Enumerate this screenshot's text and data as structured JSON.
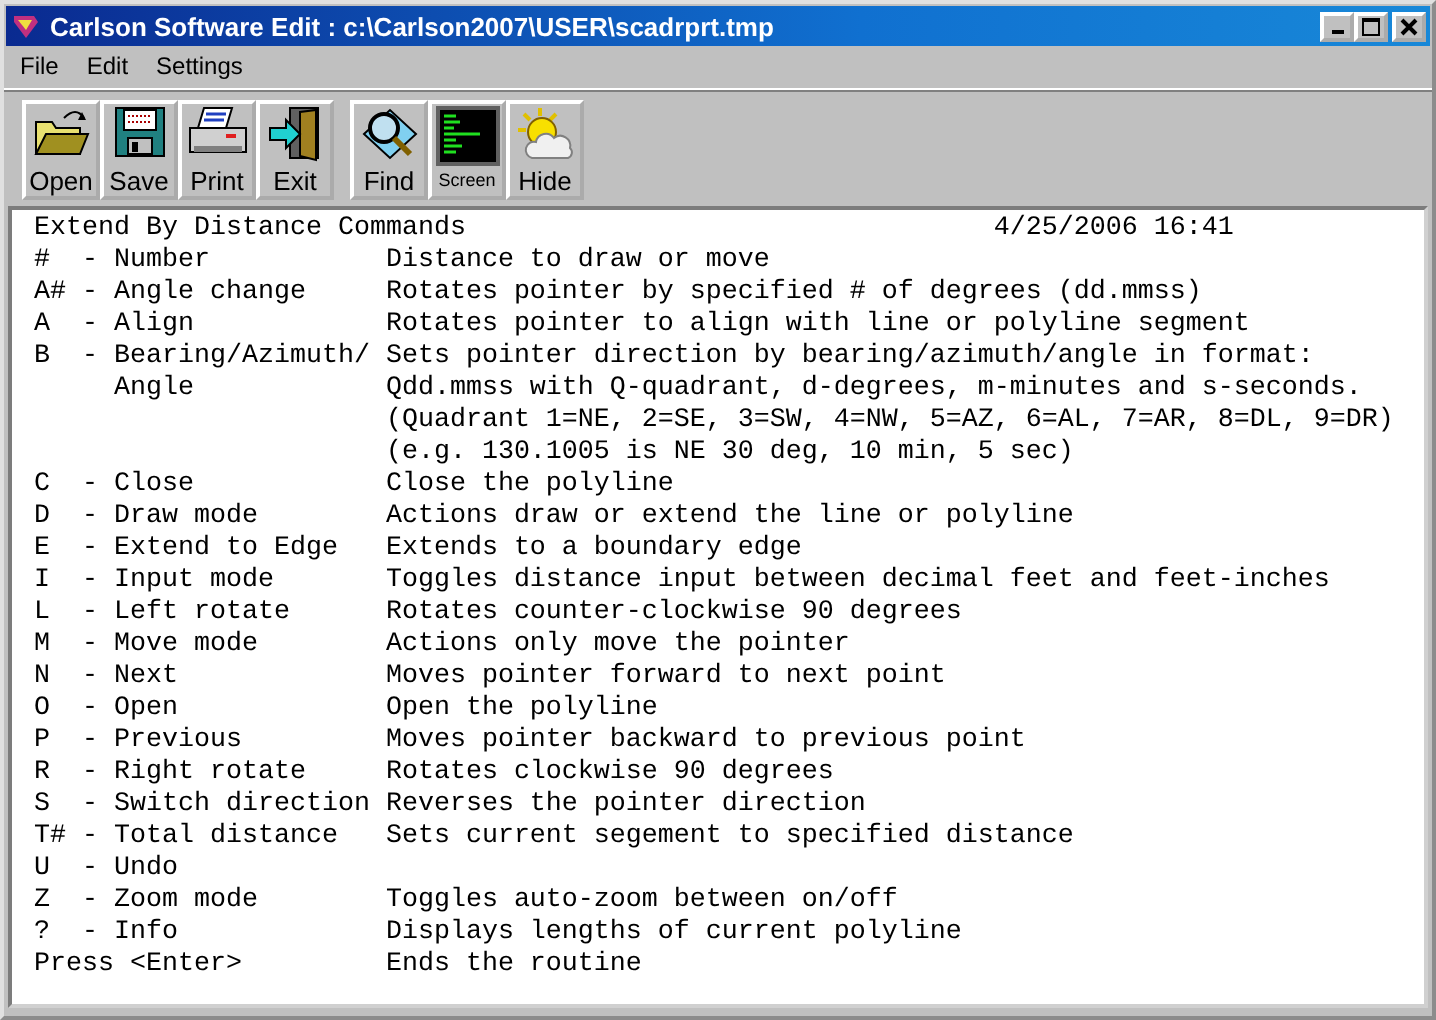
{
  "window": {
    "title": "Carlson Software Edit : c:\\Carlson2007\\USER\\scadrprt.tmp"
  },
  "menu": [
    "File",
    "Edit",
    "Settings"
  ],
  "toolbar_groups": [
    [
      {
        "label": "Open",
        "kind": "open"
      },
      {
        "label": "Save",
        "kind": "save"
      },
      {
        "label": "Print",
        "kind": "print"
      },
      {
        "label": "Exit",
        "kind": "exit"
      }
    ],
    [
      {
        "label": "Find",
        "kind": "find"
      },
      {
        "label": "Screen",
        "kind": "screen"
      },
      {
        "label": "Hide",
        "kind": "hide"
      }
    ]
  ],
  "document": {
    "heading": "Extend By Distance Commands",
    "timestamp": "4/25/2006 16:41",
    "lines": [
      {
        "kind": "command",
        "command": "#  - Number",
        "description": "Distance to draw or move"
      },
      {
        "kind": "command",
        "command": "A# - Angle change",
        "description": "Rotates pointer by specified # of degrees (dd.mmss)"
      },
      {
        "kind": "command",
        "command": "A  - Align",
        "description": "Rotates pointer to align with line or polyline segment"
      },
      {
        "kind": "command",
        "command": "B  - Bearing/Azimuth/",
        "description": "Sets pointer direction by bearing/azimuth/angle in format:"
      },
      {
        "kind": "continuation",
        "command": "Angle",
        "description": "Qdd.mmss with Q-quadrant, d-degrees, m-minutes and s-seconds."
      },
      {
        "kind": "continuation",
        "description": "(Quadrant 1=NE, 2=SE, 3=SW, 4=NW, 5=AZ, 6=AL, 7=AR, 8=DL, 9=DR)"
      },
      {
        "kind": "continuation",
        "description": "(e.g. 130.1005 is NE 30 deg, 10 min, 5 sec)"
      },
      {
        "kind": "command",
        "command": "C  - Close",
        "description": "Close the polyline"
      },
      {
        "kind": "command",
        "command": "D  - Draw mode",
        "description": "Actions draw or extend the line or polyline"
      },
      {
        "kind": "command",
        "command": "E  - Extend to Edge",
        "description": "Extends to a boundary edge"
      },
      {
        "kind": "command",
        "command": "I  - Input mode",
        "description": "Toggles distance input between decimal feet and feet-inches"
      },
      {
        "kind": "command",
        "command": "L  - Left rotate",
        "description": "Rotates counter-clockwise 90 degrees"
      },
      {
        "kind": "command",
        "command": "M  - Move mode",
        "description": "Actions only move the pointer"
      },
      {
        "kind": "command",
        "command": "N  - Next",
        "description": "Moves pointer forward to next point"
      },
      {
        "kind": "command",
        "command": "O  - Open",
        "description": "Open the polyline"
      },
      {
        "kind": "command",
        "command": "P  - Previous",
        "description": "Moves pointer backward to previous point"
      },
      {
        "kind": "command",
        "command": "R  - Right rotate",
        "description": "Rotates clockwise 90 degrees"
      },
      {
        "kind": "command",
        "command": "S  - Switch direction",
        "description": "Reverses the pointer direction"
      },
      {
        "kind": "command",
        "command": "T# - Total distance",
        "description": "Sets current segement to specified distance"
      },
      {
        "kind": "command",
        "command": "U  - Undo"
      },
      {
        "kind": "command",
        "command": "Z  - Zoom mode",
        "description": "Toggles auto-zoom between on/off"
      },
      {
        "kind": "command",
        "command": "?  - Info",
        "description": "Displays lengths of current polyline"
      },
      {
        "kind": "command",
        "command": "Press <Enter>",
        "description": "Ends the routine"
      }
    ]
  }
}
